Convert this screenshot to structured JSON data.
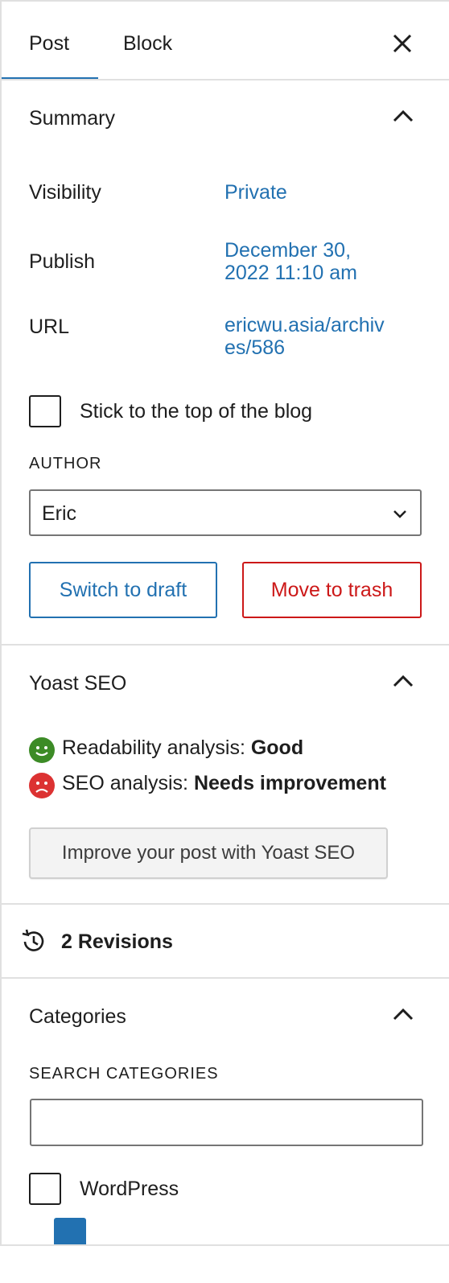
{
  "tabs": {
    "post": "Post",
    "block": "Block"
  },
  "summary": {
    "title": "Summary",
    "visibility_label": "Visibility",
    "visibility_value": "Private",
    "publish_label": "Publish",
    "publish_value_line1": "December 30,",
    "publish_value_line2": "2022 11:10 am",
    "url_label": "URL",
    "url_value_line1": "ericwu.asia/archiv",
    "url_value_line2": "es/586",
    "sticky_label": "Stick to the top of the blog",
    "author_label": "AUTHOR",
    "author_value": "Eric",
    "switch_draft": "Switch to draft",
    "move_trash": "Move to trash"
  },
  "yoast": {
    "title": "Yoast SEO",
    "readability_label": "Readability analysis: ",
    "readability_value": "Good",
    "seo_label": "SEO analysis: ",
    "seo_value": "Needs improvement",
    "button": "Improve your post with Yoast SEO"
  },
  "revisions": {
    "label": "2 Revisions"
  },
  "categories": {
    "title": "Categories",
    "search_label": "SEARCH CATEGORIES",
    "search_placeholder": "",
    "items": [
      "WordPress"
    ]
  },
  "colors": {
    "accent": "#2271b1",
    "danger": "#cc1818",
    "good": "#3c8b26",
    "bad": "#dc3232"
  }
}
